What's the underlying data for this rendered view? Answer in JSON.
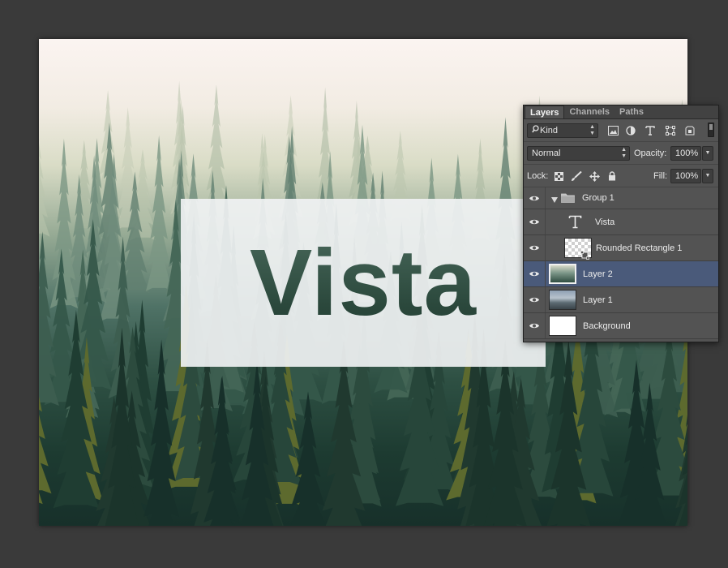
{
  "canvas": {
    "headline": "Vista"
  },
  "layers_panel": {
    "tabs": [
      {
        "label": "Layers",
        "active": true
      },
      {
        "label": "Channels",
        "active": false
      },
      {
        "label": "Paths",
        "active": false
      }
    ],
    "filter": {
      "kind_label": "Kind",
      "icons": [
        "image-filter-icon",
        "adjustment-filter-icon",
        "type-filter-icon",
        "shape-filter-icon",
        "smart-object-filter-icon"
      ]
    },
    "blend_mode": "Normal",
    "opacity_label": "Opacity:",
    "opacity_value": "100%",
    "lock_label": "Lock:",
    "fill_label": "Fill:",
    "fill_value": "100%",
    "layers": [
      {
        "name": "Group 1",
        "type": "group",
        "visible": true,
        "selected": false,
        "expanded": true
      },
      {
        "name": "Vista",
        "type": "text",
        "visible": true,
        "selected": false,
        "indented": true
      },
      {
        "name": "Rounded Rectangle 1",
        "type": "shape",
        "visible": true,
        "selected": false,
        "indented": true
      },
      {
        "name": "Layer 2",
        "type": "pixel",
        "visible": true,
        "selected": true
      },
      {
        "name": "Layer 1",
        "type": "pixel",
        "visible": true,
        "selected": false
      },
      {
        "name": "Background",
        "type": "background",
        "visible": true,
        "selected": false
      }
    ]
  },
  "colors": {
    "workspace_bg": "#3a3a3a",
    "panel_bg": "#535353",
    "selected_layer": "#4a5a7a",
    "forest_dark": "#1d3b31",
    "fog_light": "#fbf4f1"
  }
}
